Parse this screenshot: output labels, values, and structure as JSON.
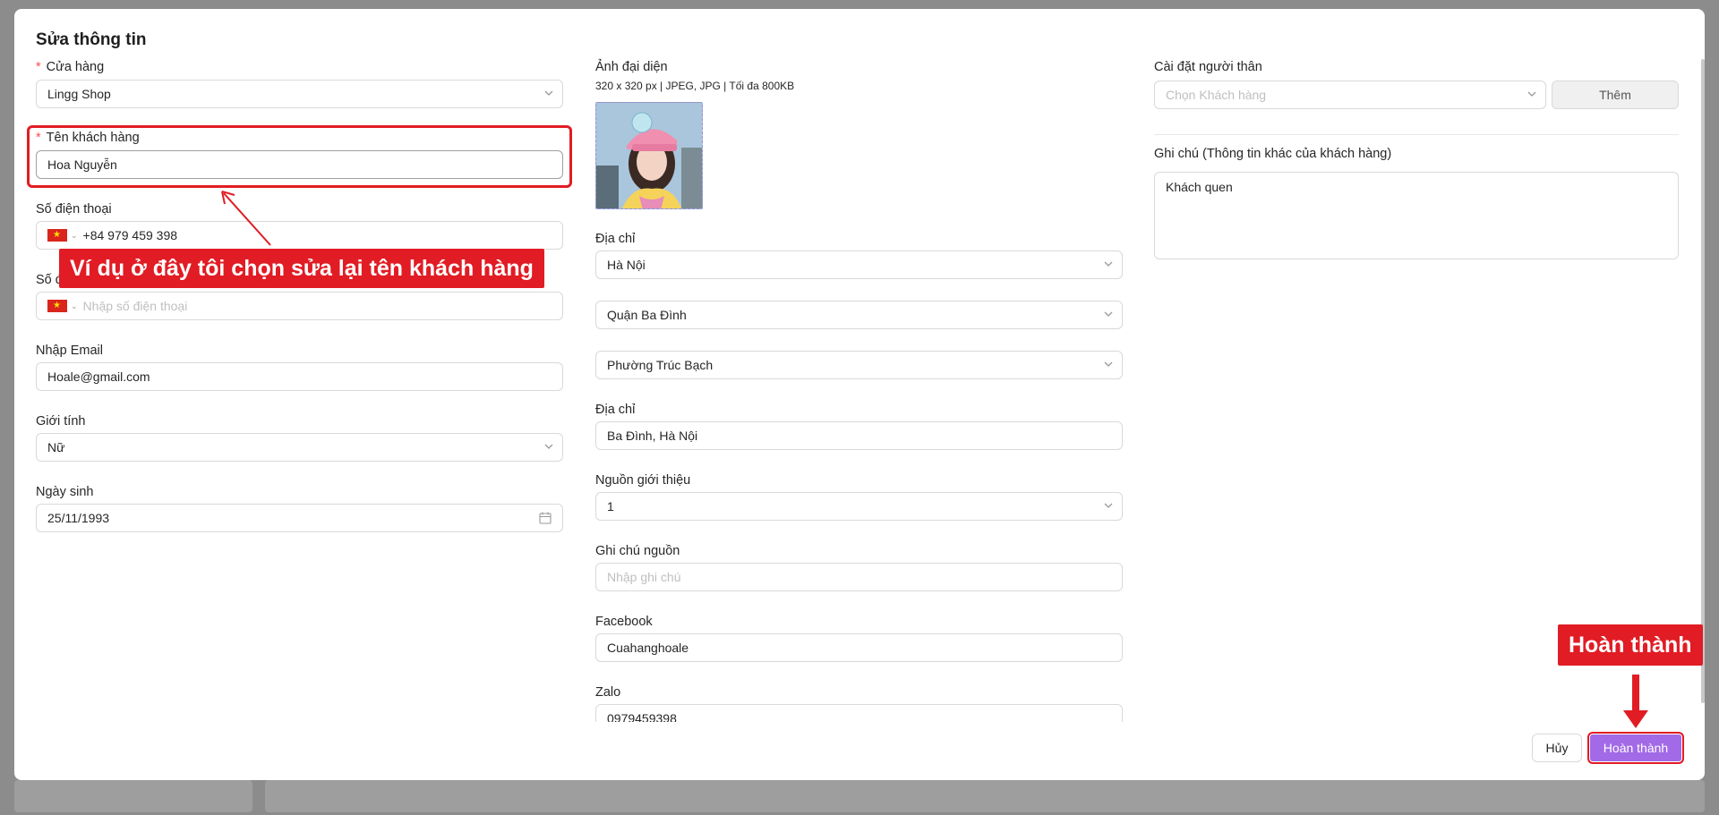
{
  "modal": {
    "title": "Sửa thông tin"
  },
  "left": {
    "store": {
      "label": "Cửa hàng",
      "value": "Lingg Shop"
    },
    "customer_name": {
      "label": "Tên khách hàng",
      "value": "Hoa Nguyễn"
    },
    "phone": {
      "label": "Số điện thoại",
      "value": "+84 979 459 398"
    },
    "phone2": {
      "label": "Số đ",
      "placeholder": "Nhập số điện thoại"
    },
    "email": {
      "label": "Nhập Email",
      "value": "Hoale@gmail.com"
    },
    "gender": {
      "label": "Giới tính",
      "value": "Nữ"
    },
    "birthday": {
      "label": "Ngày sinh",
      "value": "25/11/1993"
    }
  },
  "middle": {
    "avatar": {
      "label": "Ảnh đại diện",
      "hint": "320 x 320 px | JPEG, JPG | Tối đa 800KB"
    },
    "address_label": "Địa chỉ",
    "province": "Hà Nội",
    "district": "Quận Ba Đình",
    "ward": "Phường Trúc Bạch",
    "address_detail": {
      "label": "Địa chỉ",
      "value": "Ba Đình, Hà Nội"
    },
    "referral_source": {
      "label": "Nguồn giới thiệu",
      "value": "1"
    },
    "source_note": {
      "label": "Ghi chú nguồn",
      "placeholder": "Nhập ghi chú"
    },
    "facebook": {
      "label": "Facebook",
      "value": "Cuahanghoale"
    },
    "zalo": {
      "label": "Zalo",
      "value": "0979459398"
    }
  },
  "right": {
    "relatives": {
      "label": "Cài đặt người thân",
      "placeholder": "Chọn Khách hàng",
      "add_label": "Thêm"
    },
    "note": {
      "label": "Ghi chú (Thông tin khác của khách hàng)",
      "value": "Khách quen"
    }
  },
  "footer": {
    "cancel_label": "Hủy",
    "submit_label": "Hoàn thành"
  },
  "annotations": {
    "name_callout": "Ví dụ ở đây tôi chọn sửa lại tên khách hàng",
    "submit_callout": "Hoàn thành",
    "color": "#e11c24"
  },
  "colors": {
    "primary": "#a26ae6",
    "required": "#ff4d4f"
  }
}
